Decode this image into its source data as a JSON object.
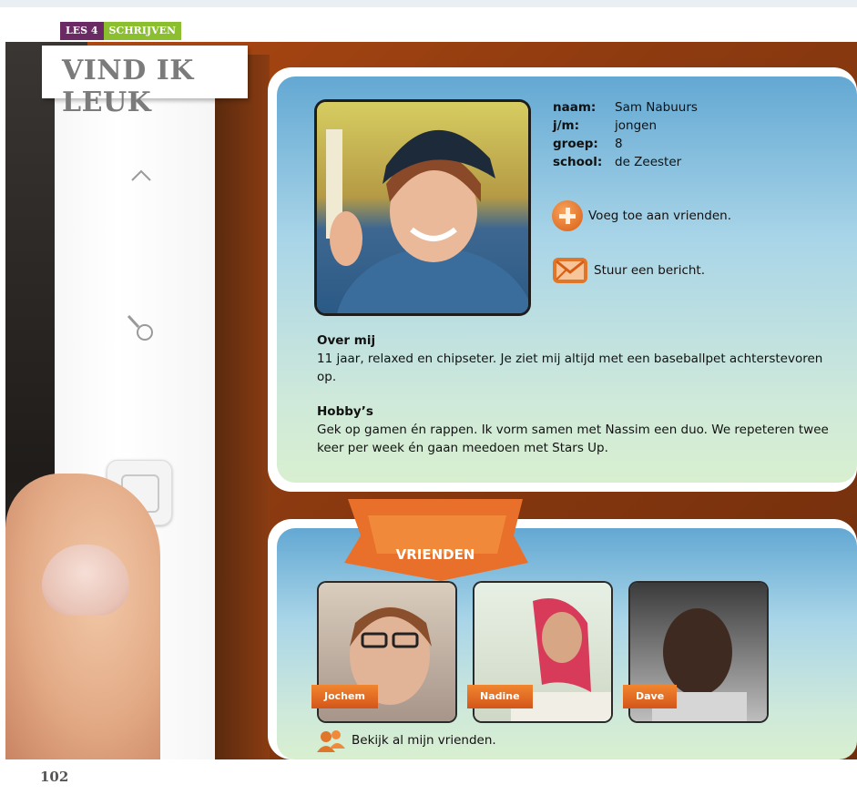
{
  "header": {
    "lesson": "LES 4",
    "section": "SCHRIJVEN",
    "title": "VIND IK LEUK"
  },
  "profile": {
    "fields": [
      {
        "label": "naam:",
        "value": "Sam Nabuurs"
      },
      {
        "label": "j/m:",
        "value": "jongen"
      },
      {
        "label": "groep:",
        "value": "8"
      },
      {
        "label": "school:",
        "value": "de Zeester"
      }
    ],
    "add_friend": "Voeg toe aan vrienden.",
    "send_message": "Stuur een bericht.",
    "about_title": "Over mij",
    "about_text": "11 jaar, relaxed en chipseter. Je ziet mij altijd met een baseballpet achterstevoren op.",
    "hobbies_title": "Hobby’s",
    "hobbies_text": "Gek op gamen én rappen. Ik vorm samen met Nassim een duo. We repeteren twee keer per week én gaan meedoen met Stars Up."
  },
  "friends": {
    "banner": "VRIENDEN",
    "items": [
      {
        "name": "Jochem"
      },
      {
        "name": "Nadine"
      },
      {
        "name": "Dave"
      }
    ],
    "view_all": "Bekijk al mijn vrienden."
  },
  "footer": {
    "page_number": "102"
  },
  "colors": {
    "accent_orange": "#e06a1f",
    "lesson_purple": "#6a2a64",
    "section_green": "#8bbf2f"
  }
}
